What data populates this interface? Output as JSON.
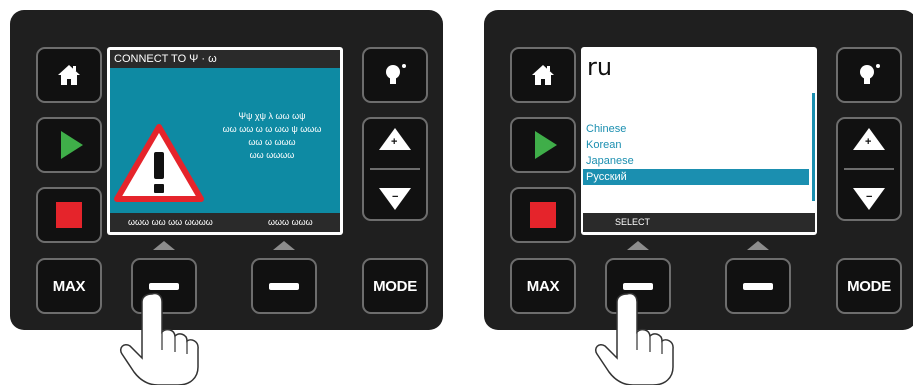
{
  "left_panel": {
    "screen": {
      "title": "CONNECT TO Ψ · ω",
      "message_lines": [
        "Ψψ χψ λ ωω ωψ",
        "ωω ωω ω ω ωω ψ ωωω",
        "ωω ω ωωω",
        "ωω ωωωω"
      ],
      "softkey_left": "ωωω ωω ωω ωωωω",
      "softkey_right": "ωωω ωωω"
    },
    "buttons": {
      "max": "MAX",
      "mode": "MODE",
      "up_sign": "+",
      "down_sign": "−"
    }
  },
  "right_panel": {
    "screen": {
      "title": "ru",
      "languages": [
        {
          "label": "Chinese",
          "selected": false
        },
        {
          "label": "Korean",
          "selected": false
        },
        {
          "label": "Japanese",
          "selected": false
        },
        {
          "label": "Русский",
          "selected": true
        }
      ],
      "softkey_left": "SELECT"
    },
    "buttons": {
      "max": "MAX",
      "mode": "MODE",
      "up_sign": "+",
      "down_sign": "−"
    }
  },
  "colors": {
    "panel": "#1f1f1f",
    "screen_accent": "#0e8aa3",
    "list_accent": "#1b8fb0",
    "play": "#3fae49",
    "stop": "#e5242b",
    "warning_red": "#e5242b"
  }
}
